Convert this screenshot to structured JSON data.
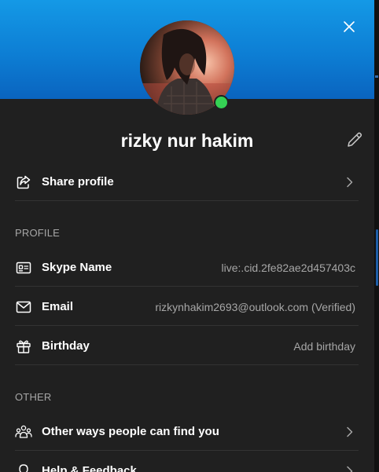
{
  "profile": {
    "display_name": "rizky nur hakim",
    "status": "online",
    "status_color": "#35d254",
    "header_color": "#0d7ed4"
  },
  "actions": {
    "share_profile_label": "Share profile"
  },
  "sections": {
    "profile_heading": "PROFILE",
    "other_heading": "OTHER"
  },
  "profile_fields": {
    "skype_name_label": "Skype Name",
    "skype_name_value": "live:.cid.2fe82ae2d457403c",
    "email_label": "Email",
    "email_value": "rizkynhakim2693@outlook.com (Verified)",
    "birthday_label": "Birthday",
    "birthday_value": "Add birthday"
  },
  "other_items": {
    "find_you_label": "Other ways people can find you",
    "help_feedback_label": "Help & Feedback"
  },
  "icons": {
    "close": "close-icon",
    "edit": "pencil-icon",
    "share": "share-icon",
    "skype_name": "id-card-icon",
    "email": "envelope-icon",
    "birthday": "gift-icon",
    "find_you": "people-icon",
    "help": "lightbulb-icon",
    "chevron": "chevron-right-icon"
  }
}
